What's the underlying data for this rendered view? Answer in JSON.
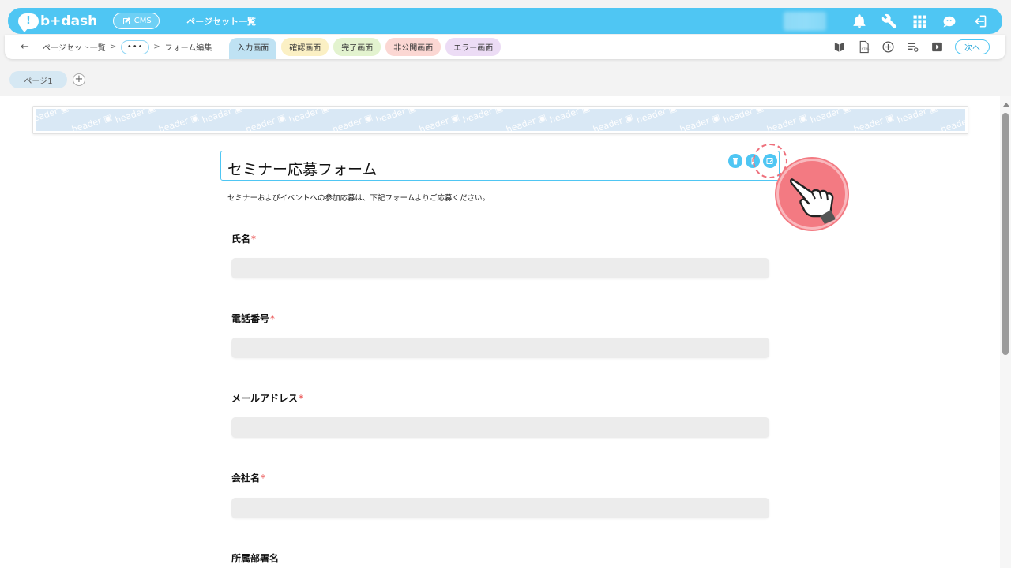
{
  "app": {
    "logo_text": "b+dash",
    "module_label": "CMS",
    "title": "ページセット一覧"
  },
  "top_icons": [
    "bell-icon",
    "wrench-icon",
    "apps-grid-icon",
    "support-chat-icon",
    "logout-icon"
  ],
  "breadcrumb": {
    "item1": "ページセット一覧",
    "sep": ">",
    "more": "•••",
    "item3": "フォーム編集"
  },
  "screen_tabs": [
    {
      "label": "入力画面",
      "color": "#bfe2f3",
      "active": true
    },
    {
      "label": "確認画面",
      "color": "#fbf0c4",
      "active": false
    },
    {
      "label": "完了画面",
      "color": "#e3f3cf",
      "active": false
    },
    {
      "label": "非公開画面",
      "color": "#fbd7d3",
      "active": false
    },
    {
      "label": "エラー画面",
      "color": "#ecdcf5",
      "active": false
    }
  ],
  "toolbar": {
    "icons": [
      "beginner-mark-icon",
      "html-file-icon",
      "add-circle-icon",
      "list-settings-icon",
      "play-video-icon"
    ],
    "next_label": "次へ"
  },
  "pages": {
    "tab_label": "ページ1",
    "add_label": "+"
  },
  "header_band": {
    "word": "header"
  },
  "form": {
    "title": "セミナー応募フォーム",
    "description": "セミナーおよびイベントへの参加応募は、下記フォームよりご応募ください。",
    "required_mark": "*",
    "fields": [
      {
        "label": "氏名",
        "required": true
      },
      {
        "label": "電話番号",
        "required": true
      },
      {
        "label": "メールアドレス",
        "required": true
      },
      {
        "label": "会社名",
        "required": true
      },
      {
        "label": "所属部署名",
        "required": false
      }
    ]
  },
  "colors": {
    "brand": "#4fc6f3",
    "focus_ring": "#ee6f7b",
    "hand_bg": "#f37a82",
    "required": "#e94a4a"
  }
}
